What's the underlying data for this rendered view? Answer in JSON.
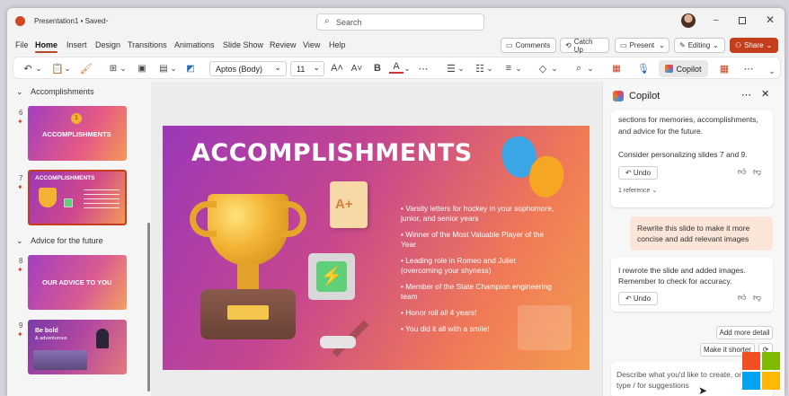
{
  "titlebar": {
    "doc_title": "Presentation1 • Saved",
    "search_placeholder": "Search"
  },
  "menu": [
    "File",
    "Home",
    "Insert",
    "Design",
    "Transitions",
    "Animations",
    "Slide Show",
    "Review",
    "View",
    "Help"
  ],
  "actions": {
    "comments": "Comments",
    "catchup": "Catch Up",
    "present": "Present",
    "editing": "Editing",
    "share": "Share"
  },
  "ribbon": {
    "font": "Aptos (Body)",
    "size": "11",
    "bold": "B",
    "copilot": "Copilot"
  },
  "sections": [
    {
      "label": "Accomplishments"
    },
    {
      "label": "Advice for the future"
    }
  ],
  "thumbnails": [
    {
      "num": "6",
      "title": "ACCOMPLISHMENTS",
      "badge": "1"
    },
    {
      "num": "7",
      "title": "ACCOMPLISHMENTS"
    },
    {
      "num": "8",
      "title": "OUR ADVICE TO YOU"
    },
    {
      "num": "9",
      "title": "Be bold",
      "subtitle": "& adventurous"
    }
  ],
  "slide": {
    "title": "ACCOMPLISHMENTS",
    "grade": "A+",
    "bullets": [
      "Varsity letters for hockey in your sophomore, junior, and senior years",
      "Winner of the Most Valuable Player of the Year",
      "Leading role in Romeo and Juliet (overcoming your shyness)",
      "Member of the State Champion engineering team",
      "Honor roll all 4 years!",
      "You did it all with a smile!"
    ]
  },
  "copilot": {
    "title": "Copilot",
    "msg1_text": "sections for memories, accomplishments, and advice for the future.",
    "msg1_text2": "Consider personalizing slides 7 and 9.",
    "undo": "Undo",
    "reference": "1 reference",
    "user_msg": "Rewrite this slide to make it more concise and add relevant images",
    "msg2_text": "I rewrote the slide and added images. Remember to check for accuracy.",
    "suggest1": "Add more detail",
    "suggest2": "Make it shorter",
    "input_placeholder": "Describe what you'd like to create, or type / for suggestions"
  }
}
